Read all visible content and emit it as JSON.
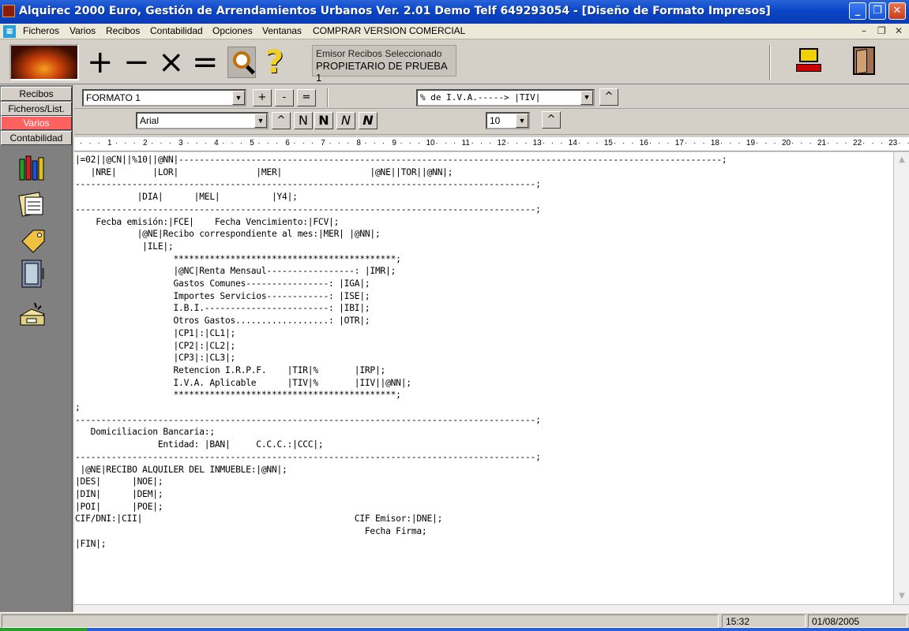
{
  "window": {
    "title": "Alquirec 2000 Euro, Gestión de Arrendamientos Urbanos Ver. 2.01 Demo Telf 649293054 - [Diseño de Formato Impresos]",
    "minimize": "_",
    "maximize": "❐",
    "close": "✕"
  },
  "menu": {
    "items": [
      "Ficheros",
      "Varios",
      "Recibos",
      "Contabilidad",
      "Opciones",
      "Ventanas",
      "COMPRAR VERSION COMERCIAL"
    ],
    "mdi_minimize": "–",
    "mdi_restore": "❐",
    "mdi_close": "✕"
  },
  "toolbar": {
    "plus": "+",
    "minus": "−",
    "times": "×",
    "equals": "=",
    "help": "?",
    "emisor_label": "Emisor Recibos Seleccionado",
    "emisor_value": "PROPIETARIO DE PRUEBA 1"
  },
  "left_tabs": [
    "Recibos",
    "Ficheros/List.",
    "Varios",
    "Contabilidad"
  ],
  "left_tab_active": "Varios",
  "format_bar": {
    "formato": "FORMATO 1",
    "plus": "+",
    "minus": "-",
    "equals": "=",
    "field_combo": "% de I.V.A.-----> |TIV|",
    "up": "^"
  },
  "font_bar": {
    "font": "Arial",
    "up": "^",
    "style_normal": "N",
    "style_bold": "N",
    "style_italic": "N",
    "style_bold_italic": "N",
    "size": "10",
    "size_up": "^"
  },
  "ruler": {
    "marks": [
      "1",
      "2",
      "3",
      "4",
      "5",
      "6",
      "7",
      "8",
      "9",
      "10",
      "11",
      "12",
      "13",
      "14",
      "15",
      "16",
      "17",
      "18",
      "19",
      "20",
      "21",
      "22",
      "23"
    ]
  },
  "editor": {
    "lines": [
      "|=02||@CN||%10||@NN|---------------------------------------------------------------------------------------------------------;",
      "   |NRE|       |LOR|               |MER|                 |@NE||TOR||@NN|;",
      "-----------------------------------------------------------------------------------------;",
      "            |DIA|      |MEL|          |Y4|;",
      "-----------------------------------------------------------------------------------------;",
      "    Fecba emisión:|FCE|    Fecha Vencimiento:|FCV|;",
      "            |@NE|Recibo correspondiente al mes:|MER| |@NN|;",
      "             |ILE|;",
      "                   *******************************************;",
      "                   |@NC|Renta Mensaul-----------------: |IMR|;",
      "                   Gastos Comunes----------------: |IGA|;",
      "                   Importes Servicios------------: |ISE|;",
      "                   I.B.I.------------------------: |IBI|;",
      "                   Otros Gastos..................: |OTR|;",
      "                   |CP1|:|CL1|;",
      "                   |CP2|:|CL2|;",
      "                   |CP3|:|CL3|;",
      "                   Retencion I.R.P.F.    |TIR|%       |IRP|;",
      "                   I.V.A. Aplicable      |TIV|%       |IIV||@NN|;",
      "                   *******************************************;",
      ";",
      "-----------------------------------------------------------------------------------------;",
      "   Domiciliacion Bancaria:;",
      "                Entidad: |BAN|     C.C.C.:|CCC|;",
      "-----------------------------------------------------------------------------------------;",
      " |@NE|RECIBO ALQUILER DEL INMUEBLE:|@NN|;",
      "|DES|      |NOE|;",
      "|DIN|      |DEM|;",
      "|POI|      |POE|;",
      "CIF/DNI:|CII|                                         CIF Emisor:|DNE|;",
      "                                                        Fecha Firma;",
      "|FIN|;"
    ]
  },
  "scroll": {
    "up": "▲",
    "down": "▼"
  },
  "status": {
    "time": "15:32",
    "date": "01/08/2005"
  }
}
